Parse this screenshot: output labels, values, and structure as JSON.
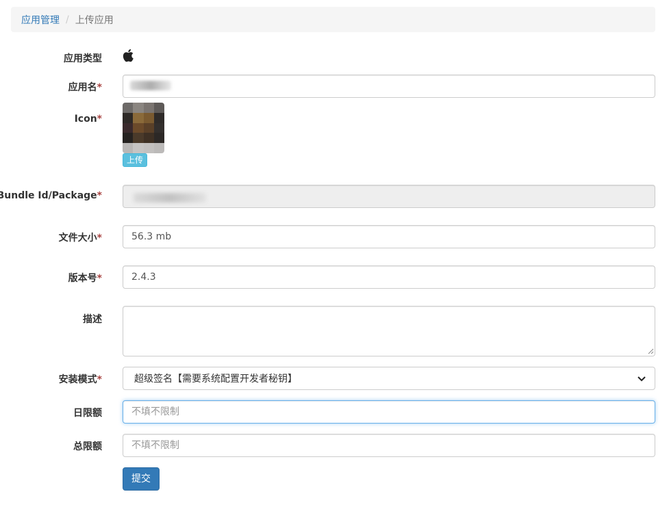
{
  "breadcrumb": {
    "parent": "应用管理",
    "separator": "/",
    "current": "上传应用"
  },
  "form": {
    "app_type": {
      "label": "应用类型",
      "value_icon": "apple-icon"
    },
    "app_name": {
      "label": "应用名",
      "required_mark": "*"
    },
    "icon": {
      "label": "Icon",
      "required_mark": "*",
      "upload_label": "上传"
    },
    "bundle_id": {
      "label": "Bundle Id/Package",
      "required_mark": "*"
    },
    "file_size": {
      "label": "文件大小",
      "required_mark": "*",
      "value": "56.3 mb"
    },
    "version": {
      "label": "版本号",
      "required_mark": "*",
      "value": "2.4.3"
    },
    "description": {
      "label": "描述",
      "value": ""
    },
    "install_mode": {
      "label": "安装模式",
      "required_mark": "*",
      "selected": "超级签名【需要系统配置开发者秘钥】"
    },
    "daily_limit": {
      "label": "日限额",
      "placeholder": "不填不限制"
    },
    "total_limit": {
      "label": "总限额",
      "placeholder": "不填不限制"
    },
    "submit_label": "提交"
  },
  "colors": {
    "primary": "#337ab7",
    "info": "#5bc0de",
    "required": "#a94442",
    "focus": "#66afe9"
  }
}
